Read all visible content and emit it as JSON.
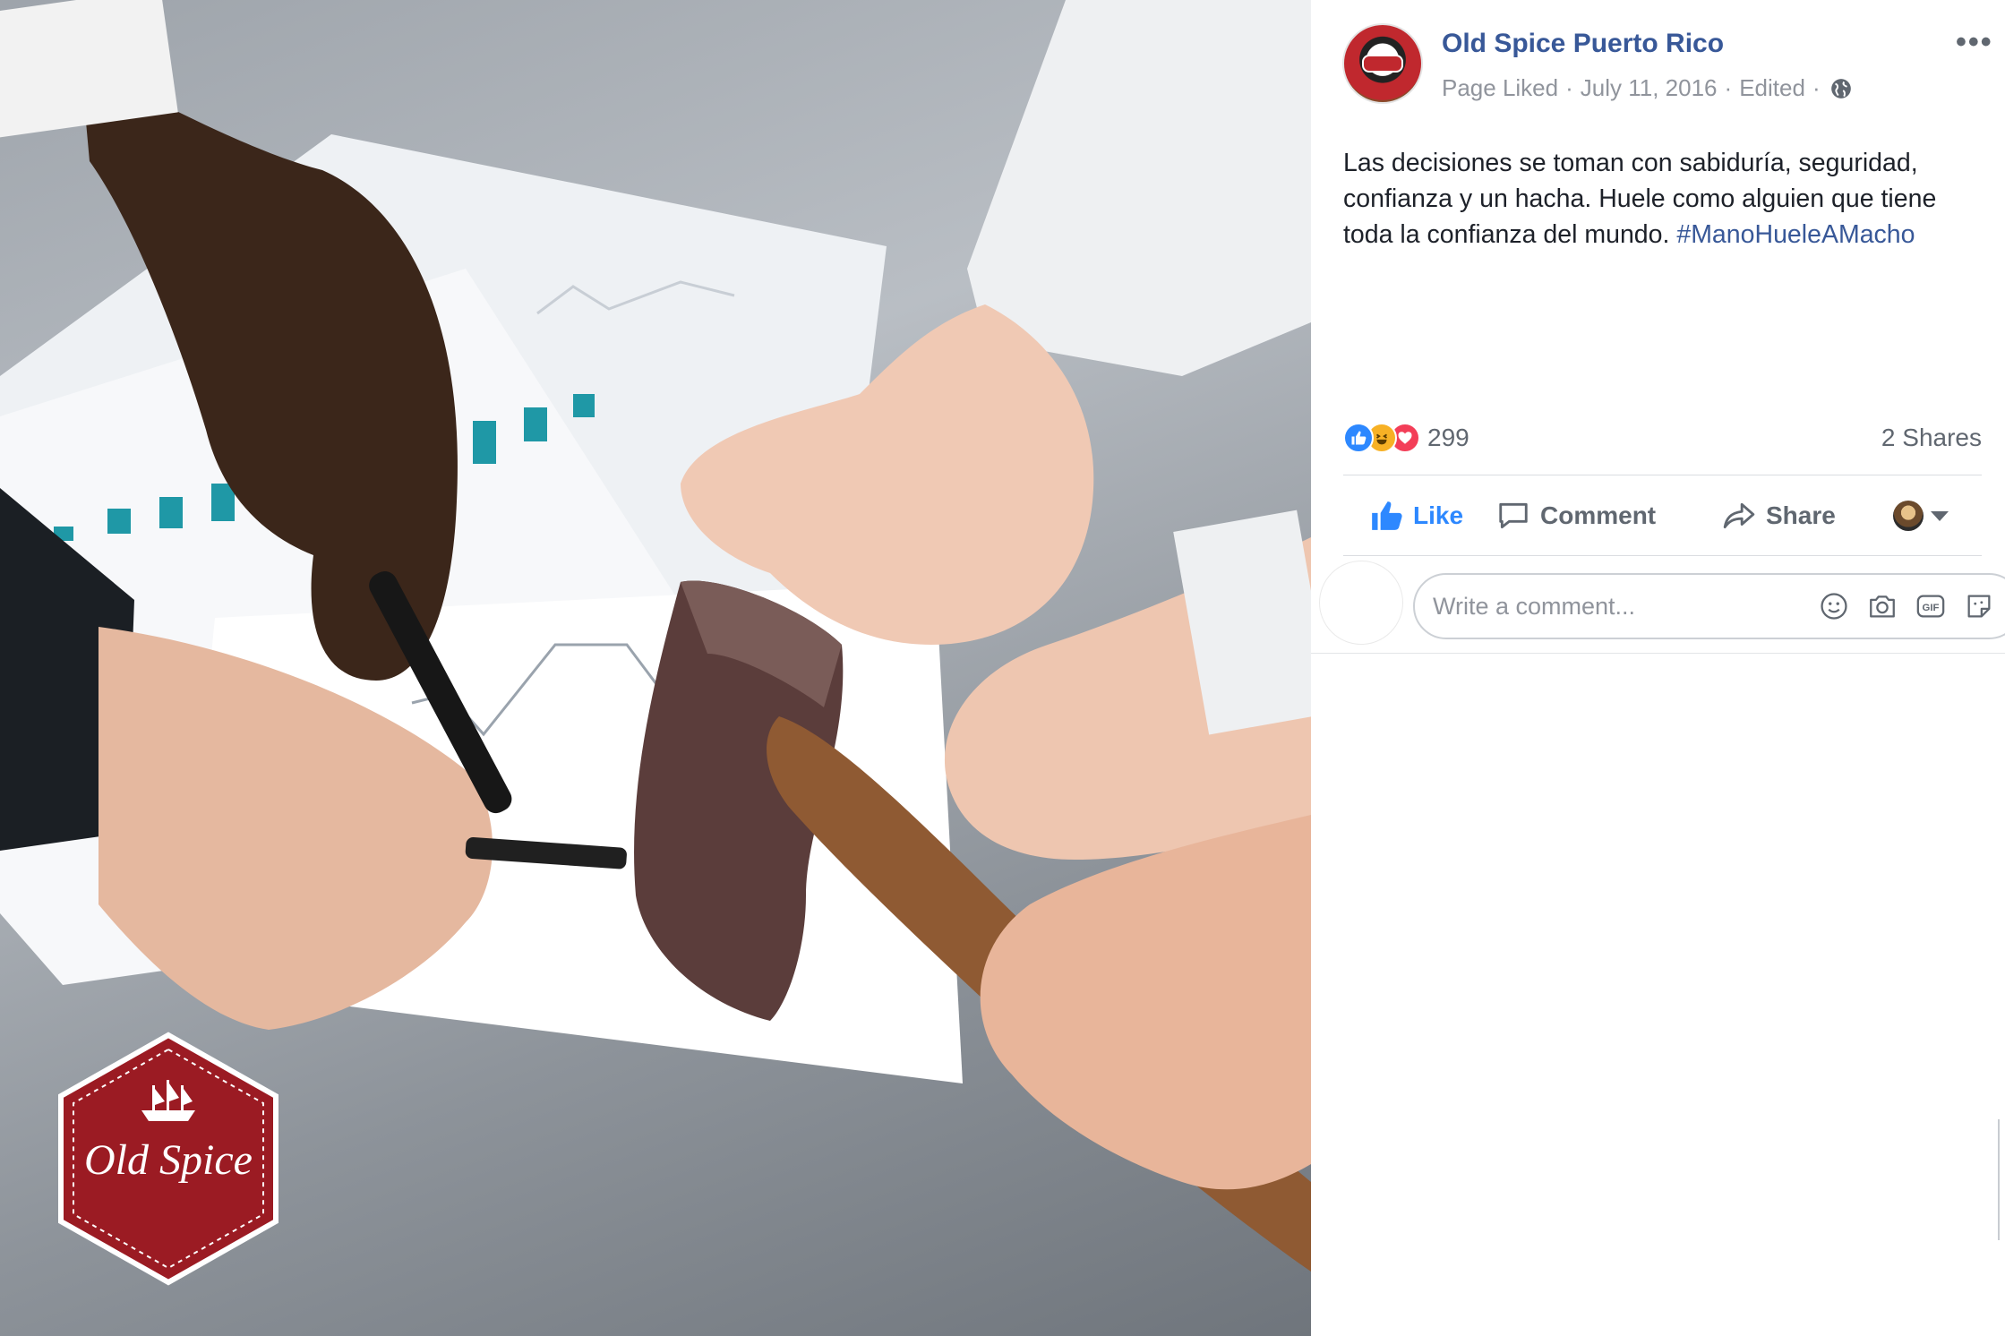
{
  "post": {
    "page_name": "Old Spice Puerto Rico",
    "meta": {
      "status": "Page Liked",
      "date": "July 11, 2016",
      "edited": "Edited",
      "separator": "·"
    },
    "more_label": "•••",
    "text": "Las decisiones se toman con sabiduría, seguridad, confianza y un hacha. Huele como alguien que tiene toda la confianza del mundo.",
    "hashtag": "#ManoHueleAMacho",
    "reaction_count": "299",
    "shares": "2 Shares",
    "actions": {
      "like": "Like",
      "comment": "Comment",
      "share": "Share"
    },
    "comment_placeholder": "Write a comment...",
    "reactions": [
      "like-icon",
      "haha-icon",
      "love-icon"
    ],
    "icons": [
      "globe-icon",
      "emoji-icon",
      "camera-icon",
      "gif-icon",
      "sticker-icon"
    ]
  },
  "photo": {
    "logo_text": "Old Spice",
    "colors": {
      "logo_red": "#9b1b23",
      "link_blue": "#385898",
      "like_blue": "#2d88ff"
    }
  }
}
